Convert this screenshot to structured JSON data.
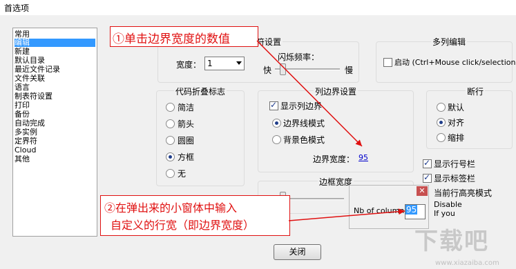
{
  "window": {
    "title": "首选项"
  },
  "sidebar": {
    "items": [
      "常用",
      "编辑",
      "新建",
      "默认目录",
      "最近文件记录",
      "文件关联",
      "语言",
      "制表符设置",
      "打印",
      "备份",
      "自动完成",
      "多实例",
      "定界符",
      "Cloud",
      "其他"
    ],
    "selected": "编辑"
  },
  "insert_caret": {
    "title": "插入符设置",
    "width_label": "宽度：",
    "width_value": "1",
    "blink_label": "闪烁频率：",
    "fast": "快",
    "slow": "慢"
  },
  "multi_edit": {
    "title": "多列编辑",
    "enable_label": "启动 (Ctrl+Mouse click/selection)"
  },
  "fold": {
    "title": "代码折叠标志",
    "options": [
      "简洁",
      "箭头",
      "圆圈",
      "方框",
      "无"
    ],
    "selected": "方框"
  },
  "column_edge": {
    "title": "列边界设置",
    "show_label": "显示列边界",
    "mode_line": "边界线模式",
    "mode_bg": "背景色模式",
    "width_label": "边界宽度：",
    "width_value": "95"
  },
  "wrap": {
    "title": "断行",
    "options": [
      "默认",
      "对齐",
      "缩排"
    ],
    "selected": "对齐"
  },
  "border": {
    "title": "边框宽度"
  },
  "right_checks": {
    "line_number": "显示行号栏",
    "bookmark": "显示标签栏",
    "highlight": "当前行高亮模式",
    "disable": "Disable",
    "if_you": "If you"
  },
  "popup": {
    "label": "Nb of column:",
    "value": "95",
    "close": "✕"
  },
  "annotations": {
    "step1": "①单击边界宽度的数值",
    "step2_line1": "②在弹出来的小窗体中输入",
    "step2_line2": "自定义的行宽（即边界宽度）"
  },
  "buttons": {
    "close": "关闭"
  },
  "watermark": {
    "logo": "下载吧",
    "sub": "www.xiazaiba.com"
  },
  "colors": {
    "annotation": "#e01010",
    "selection": "#3399ff",
    "link": "#0000cc"
  }
}
